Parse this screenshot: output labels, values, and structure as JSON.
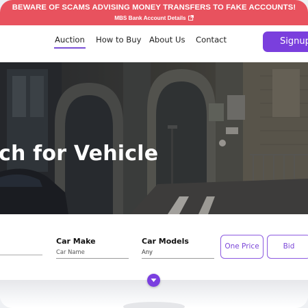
{
  "banner": {
    "warning": "BEWARE OF SCAMS ADVISING MONEY TRANSFERS TO FAKE ACCOUNTS!",
    "link_label": "MBS Bank Account Details",
    "link_icon": "external-link-icon",
    "background": "#e8525e"
  },
  "nav": {
    "items": [
      {
        "label": "Auction",
        "active": true
      },
      {
        "label": "How to Buy",
        "active": false
      },
      {
        "label": "About Us",
        "active": false
      },
      {
        "label": "Contact",
        "active": false
      }
    ],
    "signup_label": "Signup",
    "accent": "#7a3fdd"
  },
  "hero": {
    "title": "ch for Vehicle"
  },
  "search": {
    "fields": [
      {
        "label": "Car Make",
        "value": "Car Name"
      },
      {
        "label": "Car Models",
        "value": "Any"
      }
    ],
    "buttons": {
      "one_price": "One Price",
      "bid": "Bid"
    },
    "expand_icon": "chevron-down-icon"
  }
}
